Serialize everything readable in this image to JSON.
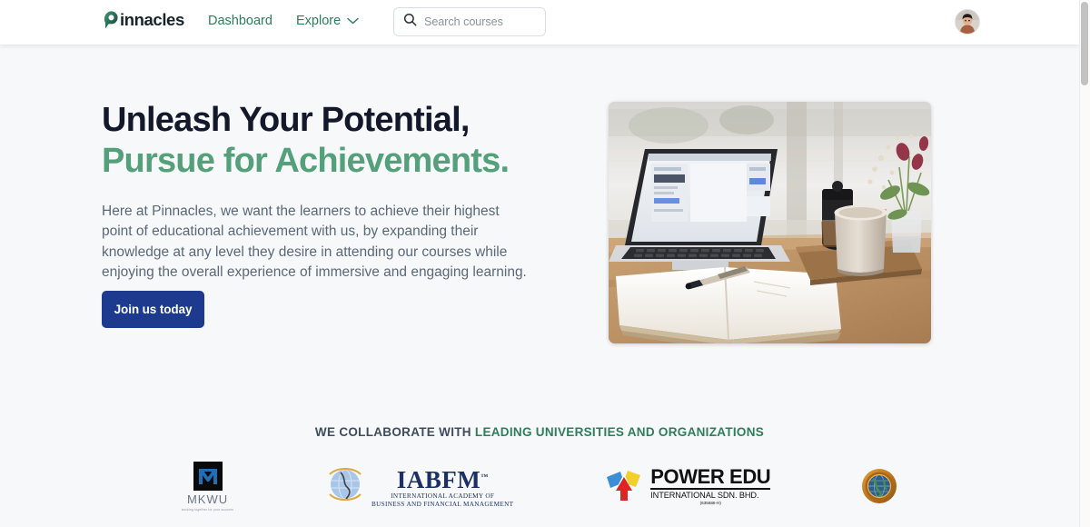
{
  "theme": {
    "page_bg": "#f7f8fa",
    "header_bg": "#ffffff",
    "brand_green": "#2e7d5b",
    "heading_green": "#53a07a",
    "heading_dark": "#13192b",
    "cta_navy": "#1e3a8f",
    "body_text": "#5a6878"
  },
  "header": {
    "logo": {
      "text": "innacles",
      "icon": "pin-p-logo-icon"
    },
    "nav": [
      {
        "label": "Dashboard",
        "id": "dashboard",
        "has_caret": false
      },
      {
        "label": "Explore",
        "id": "explore",
        "has_caret": true,
        "caret_icon": "chevron-down-icon"
      }
    ],
    "search": {
      "placeholder": "Search courses",
      "value": "",
      "icon": "search-icon"
    },
    "avatar": {
      "icon": "user-avatar",
      "alt": "User profile"
    }
  },
  "hero": {
    "heading_line1": "Unleash Your Potential,",
    "heading_line2": "Pursue for Achievements.",
    "paragraph": "Here at Pinnacles, we want the learners to achieve their highest point of educational achievement with us, by expanding their knowledge at any level they desire in attending our courses while enjoying the overall experience of immersive and engaging learning.",
    "cta_label": "Join us today",
    "image_alt": "laptop-notebook-coffee-photo"
  },
  "partners": {
    "tagline_prefix": "WE COLLABORATE WITH ",
    "tagline_highlight": "LEADING UNIVERSITIES AND ORGANIZATIONS",
    "logos": [
      {
        "id": "mkwu",
        "name": "MKWU",
        "tagline": "working together for your success",
        "icon": "mkwu-logo-icon"
      },
      {
        "id": "iabfm",
        "name": "IABFM",
        "trademark": "™",
        "sub1": "INTERNATIONAL  ACADEMY  OF",
        "sub2": "BUSINESS  AND FINANCIAL  MANAGEMENT",
        "icon": "iabfm-globe-icon"
      },
      {
        "id": "power-edu",
        "name": "POWER EDU",
        "sub": "INTERNATIONAL SDN. BHD.",
        "reg": "(635686-H)",
        "icon": "power-edu-arrow-icon"
      },
      {
        "id": "seal",
        "name": "",
        "icon": "gold-seal-globe-icon"
      }
    ]
  },
  "scrollbar": {
    "position": "top",
    "orientation": "vertical"
  }
}
